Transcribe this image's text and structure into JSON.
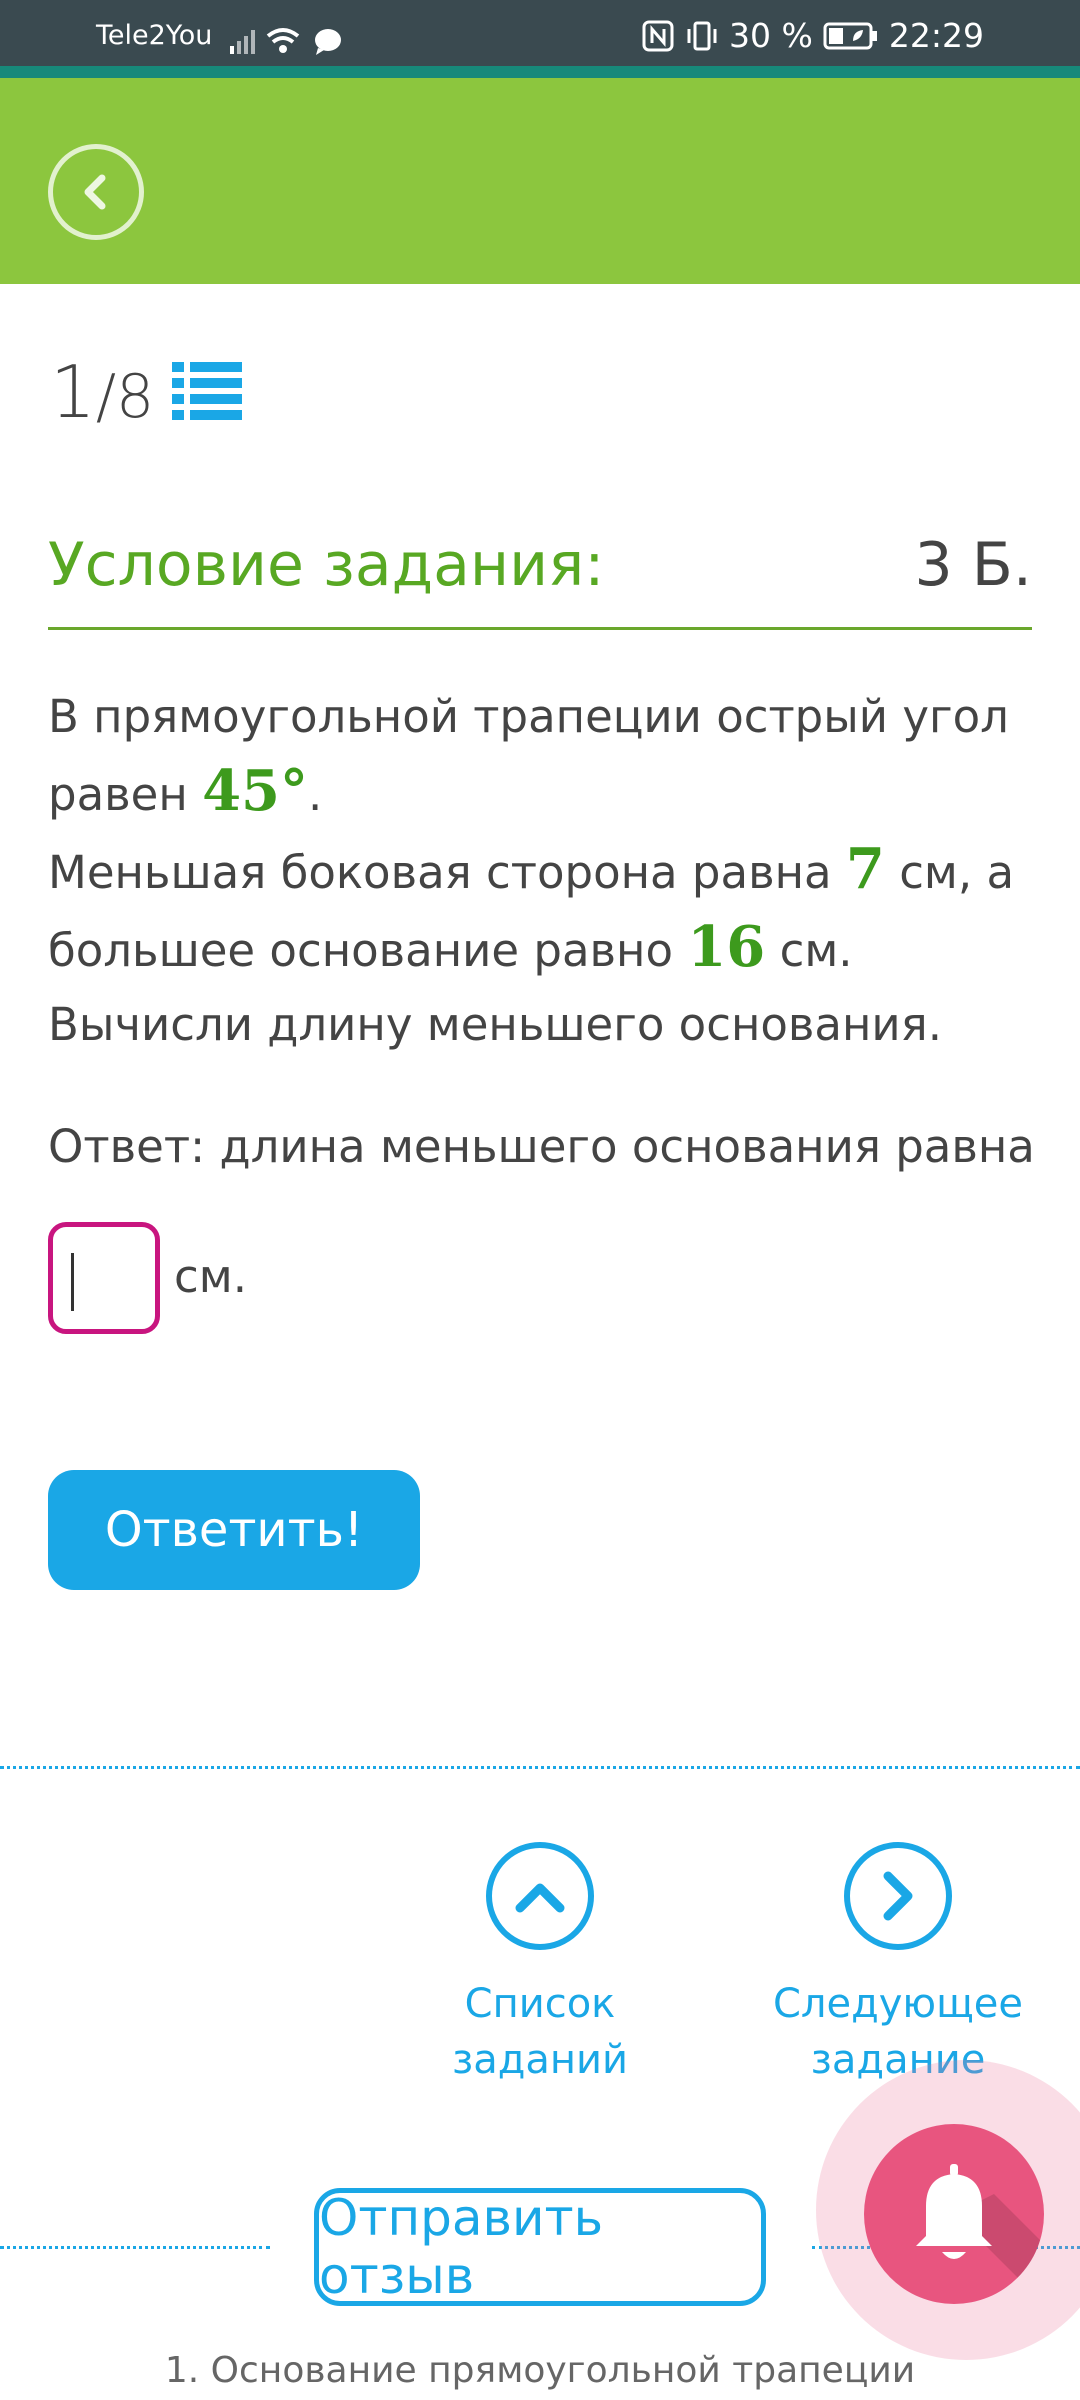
{
  "status": {
    "carrier": "Tele2You",
    "battery": "30 %",
    "time": "22:29"
  },
  "counter": {
    "current": "1",
    "total": "/8"
  },
  "condition": {
    "title": "Условие задания:",
    "points": "3 Б."
  },
  "task": {
    "text1": "В прямоугольной трапеции острый угол равен",
    "angle": "45°",
    "text2": ".",
    "text3": "Меньшая боковая сторона равна",
    "side": "7",
    "text4": "см, а большее основание равно",
    "base": "16",
    "text5": "см.",
    "text6": "Вычисли длину меньшего основания."
  },
  "answer": {
    "label": "Ответ: длина меньшего основания равна",
    "value": "",
    "unit": "см."
  },
  "buttons": {
    "submit": "Ответить!",
    "feedback": "Отправить отзыв"
  },
  "nav": {
    "list_line1": "Список",
    "list_line2": "заданий",
    "next_line1": "Следующее",
    "next_line2": "задание"
  },
  "footer": "1. Основание прямоугольной трапеции",
  "colors": {
    "appbar": "#8cc63e",
    "accent_blue": "#1aa7e6",
    "condition_green": "#58a823",
    "input_border": "#c8157f",
    "bell": "#e8557f"
  }
}
